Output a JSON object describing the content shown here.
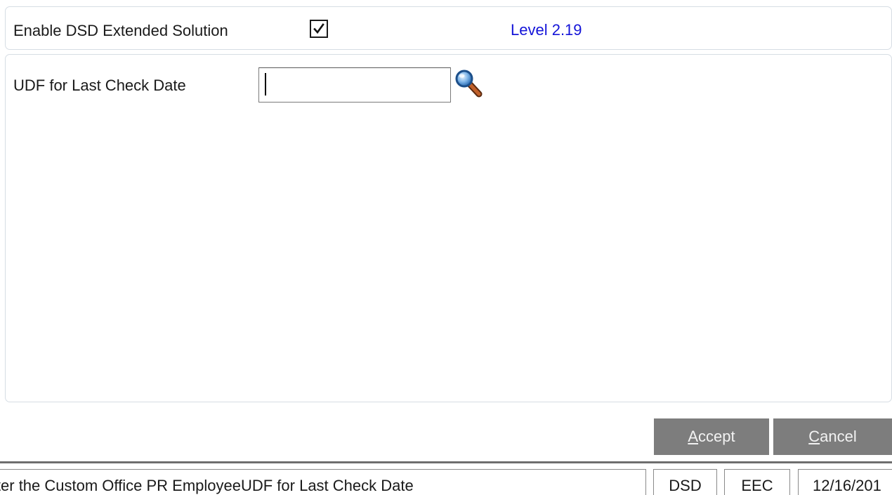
{
  "form": {
    "enable_label": "Enable DSD Extended Solution",
    "enable_checked": true,
    "level_text": "Level  2.19",
    "udf_label": "UDF for Last Check Date",
    "udf_value": ""
  },
  "icons": {
    "checkbox_check": "check-mark-icon",
    "lookup": "magnifier-icon"
  },
  "buttons": {
    "accept_mnemonic": "A",
    "accept_rest": "ccept",
    "cancel_mnemonic": "C",
    "cancel_rest": "ancel"
  },
  "status_bar": {
    "message": "Enter the Custom Office PR EmployeeUDF for Last Check Date",
    "app": "DSD",
    "module": "EEC",
    "date": "12/16/201"
  },
  "colors": {
    "level_text": "#1414d8",
    "button_bg": "#7d7d7d",
    "panel_border": "#d6dde4"
  }
}
